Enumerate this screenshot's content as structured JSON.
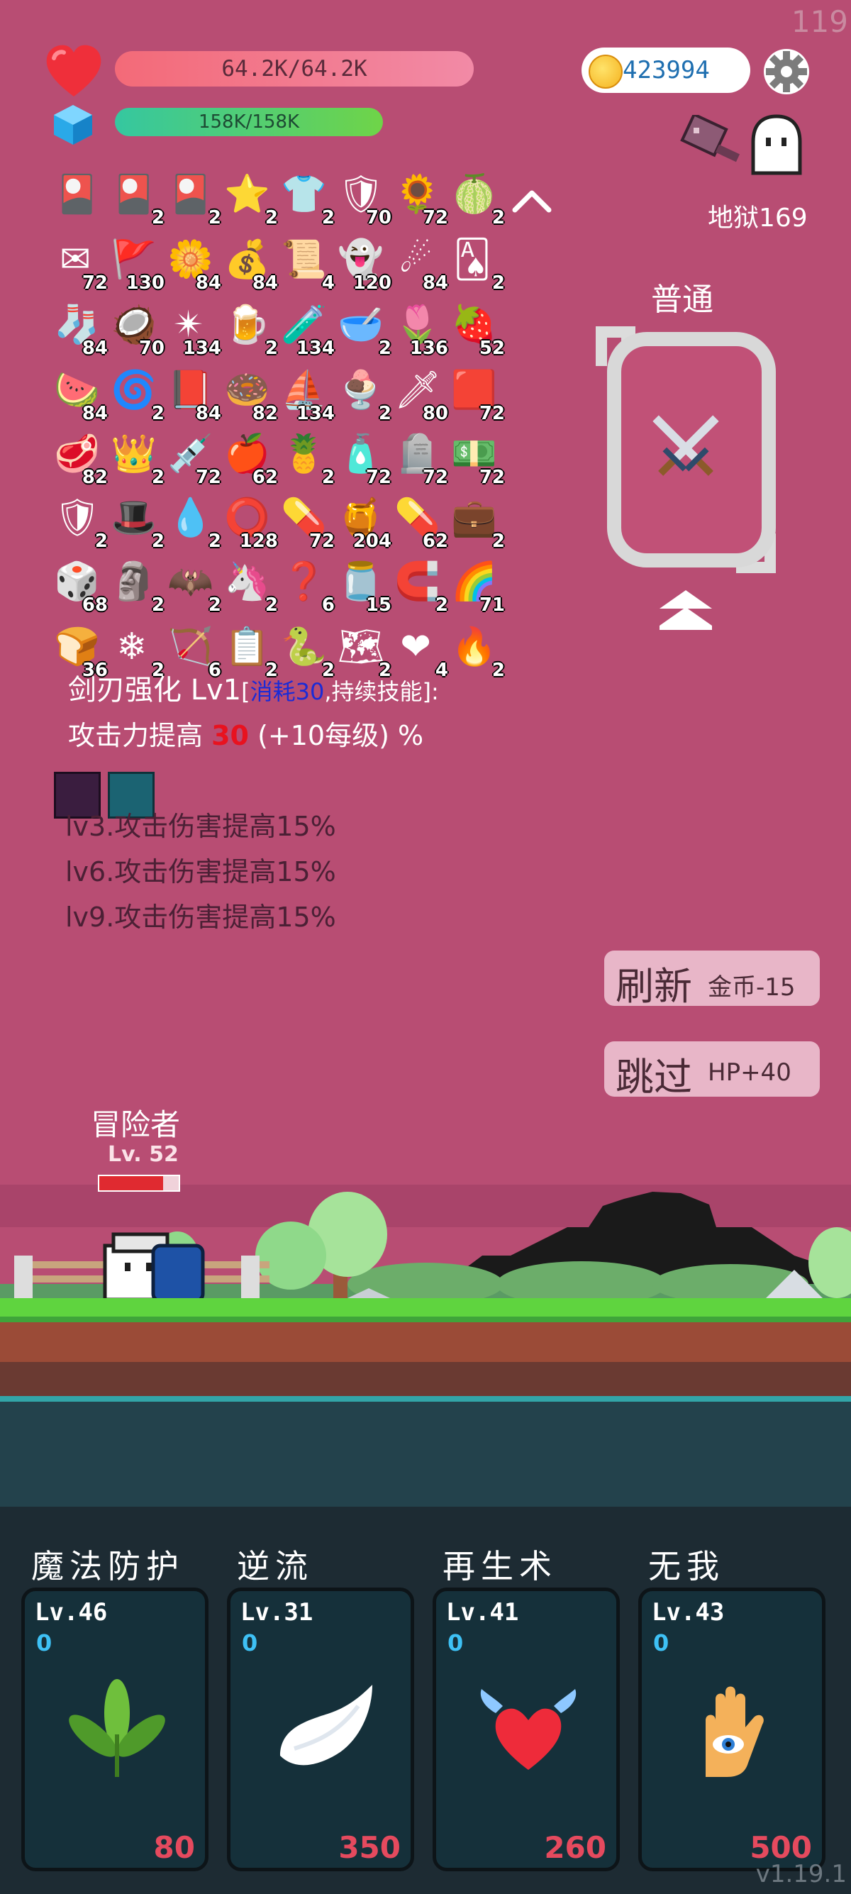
{
  "status": {
    "hp_text": "64.2K/64.2K",
    "mp_text": "158K/158K",
    "gold": "423994",
    "corner_number": "119",
    "stage": "地狱169"
  },
  "items": [
    {
      "icon": "card-icon",
      "glyph": "🎴",
      "count": ""
    },
    {
      "icon": "card-icon",
      "glyph": "🎴",
      "count": "2"
    },
    {
      "icon": "card-icon",
      "glyph": "🎴",
      "count": "2"
    },
    {
      "icon": "star-card-icon",
      "glyph": "⭐",
      "count": "2"
    },
    {
      "icon": "shirt-icon",
      "glyph": "👕",
      "count": "2"
    },
    {
      "icon": "armor-icon",
      "glyph": "🛡",
      "count": "70"
    },
    {
      "icon": "sunflower-icon",
      "glyph": "🌻",
      "count": "72"
    },
    {
      "icon": "durian-icon",
      "glyph": "🍈",
      "count": "2"
    },
    {
      "icon": "envelope-icon",
      "glyph": "✉",
      "count": "72"
    },
    {
      "icon": "flag-icon",
      "glyph": "🚩",
      "count": "130"
    },
    {
      "icon": "flower-icon",
      "glyph": "🌼",
      "count": "84"
    },
    {
      "icon": "coins-icon",
      "glyph": "💰",
      "count": "84"
    },
    {
      "icon": "scroll-icon",
      "glyph": "📜",
      "count": "4"
    },
    {
      "icon": "ghost-icon",
      "glyph": "👻",
      "count": "120"
    },
    {
      "icon": "meteor-icon",
      "glyph": "☄",
      "count": "84"
    },
    {
      "icon": "poker-card-icon",
      "glyph": "🂡",
      "count": "2"
    },
    {
      "icon": "sock-icon",
      "glyph": "🧦",
      "count": "84"
    },
    {
      "icon": "coconut-icon",
      "glyph": "🥥",
      "count": "70"
    },
    {
      "icon": "spiked-ball-icon",
      "glyph": "✴",
      "count": "134"
    },
    {
      "icon": "beer-icon",
      "glyph": "🍺",
      "count": "2"
    },
    {
      "icon": "potion-icon",
      "glyph": "🧪",
      "count": "134"
    },
    {
      "icon": "mortar-icon",
      "glyph": "🥣",
      "count": "2"
    },
    {
      "icon": "tulip-icon",
      "glyph": "🌷",
      "count": "136"
    },
    {
      "icon": "strawberry-icon",
      "glyph": "🍓",
      "count": "52"
    },
    {
      "icon": "watermelon-icon",
      "glyph": "🍉",
      "count": "84"
    },
    {
      "icon": "spiral-icon",
      "glyph": "🌀",
      "count": "2"
    },
    {
      "icon": "book-icon",
      "glyph": "📕",
      "count": "84"
    },
    {
      "icon": "donut-icon",
      "glyph": "🍩",
      "count": "82"
    },
    {
      "icon": "ship-icon",
      "glyph": "⛵",
      "count": "134"
    },
    {
      "icon": "ice-cream-icon",
      "glyph": "🍨",
      "count": "2"
    },
    {
      "icon": "sword-icon",
      "glyph": "🗡",
      "count": "80"
    },
    {
      "icon": "red-card-icon",
      "glyph": "🟥",
      "count": "72"
    },
    {
      "icon": "meat-icon",
      "glyph": "🥩",
      "count": "82"
    },
    {
      "icon": "crown-icon",
      "glyph": "👑",
      "count": "2"
    },
    {
      "icon": "needle-icon",
      "glyph": "💉",
      "count": "72"
    },
    {
      "icon": "apple-icon",
      "glyph": "🍎",
      "count": "62"
    },
    {
      "icon": "pineapple-icon",
      "glyph": "🍍",
      "count": "2"
    },
    {
      "icon": "spray-icon",
      "glyph": "🧴",
      "count": "72"
    },
    {
      "icon": "tombstone-icon",
      "glyph": "🪦",
      "count": "72"
    },
    {
      "icon": "money-icon",
      "glyph": "💵",
      "count": "72"
    },
    {
      "icon": "shield-icon",
      "glyph": "🛡",
      "count": "2"
    },
    {
      "icon": "wizard-hat-icon",
      "glyph": "🎩",
      "count": "2"
    },
    {
      "icon": "flame-drop-icon",
      "glyph": "💧",
      "count": "2"
    },
    {
      "icon": "wheel-icon",
      "glyph": "⭕",
      "count": "128"
    },
    {
      "icon": "pill-icon",
      "glyph": "💊",
      "count": "72"
    },
    {
      "icon": "jam-jar-icon",
      "glyph": "🍯",
      "count": "204"
    },
    {
      "icon": "capsule-icon",
      "glyph": "💊",
      "count": "62"
    },
    {
      "icon": "briefcase-icon",
      "glyph": "💼",
      "count": "2"
    },
    {
      "icon": "dice-icon",
      "glyph": "🎲",
      "count": "68"
    },
    {
      "icon": "figure-icon",
      "glyph": "🗿",
      "count": "2"
    },
    {
      "icon": "bat-icon",
      "glyph": "🦇",
      "count": "2"
    },
    {
      "icon": "unicorn-icon",
      "glyph": "🦄",
      "count": "2"
    },
    {
      "icon": "hook-icon",
      "glyph": "❓",
      "count": "6"
    },
    {
      "icon": "jar-icon",
      "glyph": "🫙",
      "count": "15"
    },
    {
      "icon": "magnet-icon",
      "glyph": "🧲",
      "count": "2"
    },
    {
      "icon": "rainbow-icon",
      "glyph": "🌈",
      "count": "71"
    },
    {
      "icon": "bread-icon",
      "glyph": "🍞",
      "count": "36"
    },
    {
      "icon": "sparkle-icon",
      "glyph": "❄",
      "count": "2"
    },
    {
      "icon": "bow-icon",
      "glyph": "🏹",
      "count": "6"
    },
    {
      "icon": "list-icon",
      "glyph": "📋",
      "count": "2"
    },
    {
      "icon": "snake-icon",
      "glyph": "🐍",
      "count": "2"
    },
    {
      "icon": "map-icon",
      "glyph": "🗺",
      "count": "2"
    },
    {
      "icon": "heart-icon",
      "glyph": "❤",
      "count": "4"
    },
    {
      "icon": "fire-icon",
      "glyph": "🔥",
      "count": "2"
    }
  ],
  "mode": {
    "label": "普通"
  },
  "skill_desc": {
    "title": "剑刃强化 Lv1",
    "cost": "消耗30",
    "cost_pre": "[",
    "cost_post": ",持续技能]:",
    "line_pre": "攻击力提高 ",
    "line_value": "30",
    "line_post": " (+10每级) %",
    "bonuses": [
      "lv3.攻击伤害提高15%",
      "lv6.攻击伤害提高15%",
      "lv9.攻击伤害提高15%"
    ]
  },
  "buttons": {
    "refresh_big": "刷新",
    "refresh_small": "金币-15",
    "skip_big": "跳过",
    "skip_small": "HP+40"
  },
  "hero": {
    "name": "冒险者",
    "level": "Lv. 52",
    "hp_fraction": 0.8
  },
  "skills": [
    {
      "name": "魔法防护",
      "level": "Lv.46",
      "value": "0",
      "cost": "80",
      "art": "leaf-icon"
    },
    {
      "name": "逆流",
      "level": "Lv.31",
      "value": "0",
      "cost": "350",
      "art": "wing-icon"
    },
    {
      "name": "再生术",
      "level": "Lv.41",
      "value": "0",
      "cost": "260",
      "art": "winged-heart-icon"
    },
    {
      "name": "无我",
      "level": "Lv.43",
      "value": "0",
      "cost": "500",
      "art": "eye-hand-icon"
    }
  ],
  "version": "v1.19.1",
  "colors": {
    "background": "#b84d73",
    "hp_bar": "#f36a78",
    "mp_bar": "#35c7a0",
    "cost_red": "#e54a5e",
    "skill_blue": "#3ec1f5"
  }
}
